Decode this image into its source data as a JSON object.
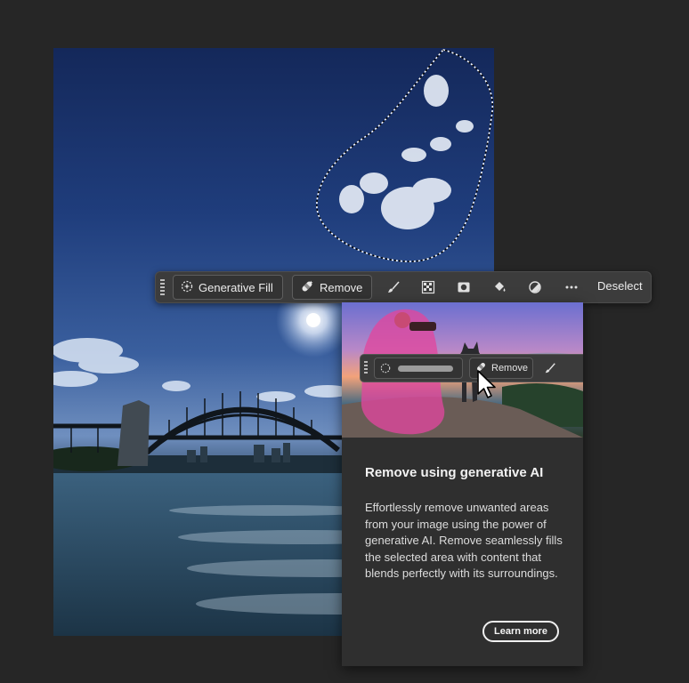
{
  "toolbar": {
    "generative_fill_label": "Generative Fill",
    "remove_label": "Remove",
    "deselect_label": "Deselect",
    "icons": [
      "brush-icon",
      "checker-mask-icon",
      "mask-icon",
      "paint-bucket-icon",
      "adjustment-icon",
      "more-icon"
    ]
  },
  "panel": {
    "preview_remove_label": "Remove",
    "title": "Remove using generative AI",
    "body": "Effortlessly remove unwanted areas from your image using the power of generative AI. Remove seamlessly fills the selected area with content that blends perfectly with its surroundings.",
    "learn_more_label": "Learn more"
  },
  "colors": {
    "app_background": "#262626",
    "toolbar_background": "#3c3c3c",
    "panel_background": "#2f2f2f",
    "selection_highlight": "#e0479e"
  }
}
